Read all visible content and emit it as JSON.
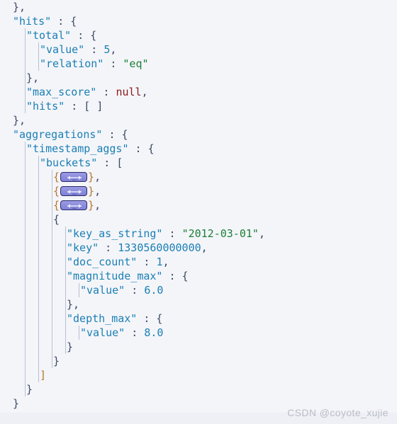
{
  "editor": {
    "background_color": "#f4f5f9",
    "indent_guide_color": "#b9c0d0",
    "colors": {
      "punctuation": "#3b4a66",
      "key": "#1a7fb5",
      "string": "#1a7f37",
      "number": "#1a7fb5",
      "null": "#8b1a1a",
      "fold_brace": "#b8762a",
      "fold_chip_fill": "#8c8cdd",
      "fold_chip_border": "#2b2b6b",
      "watermark": "#b9bdc6"
    },
    "fold_chip": {
      "icon_name": "collapsed-region-arrows-icon",
      "tooltip": "Expand folded region"
    }
  },
  "document": {
    "language": "json",
    "title": "Elasticsearch search response",
    "lines": [
      {
        "n": 1,
        "indent": 0,
        "tokens": [
          {
            "t": "punct",
            "v": "},"
          }
        ]
      },
      {
        "n": 2,
        "indent": 0,
        "tokens": [
          {
            "t": "key",
            "v": "\"hits\""
          },
          {
            "t": "punct",
            "v": " : {"
          }
        ]
      },
      {
        "n": 3,
        "indent": 1,
        "tokens": [
          {
            "t": "key",
            "v": "\"total\""
          },
          {
            "t": "punct",
            "v": " : {"
          }
        ]
      },
      {
        "n": 4,
        "indent": 2,
        "tokens": [
          {
            "t": "key",
            "v": "\"value\""
          },
          {
            "t": "punct",
            "v": " : "
          },
          {
            "t": "num",
            "v": "5"
          },
          {
            "t": "punct",
            "v": ","
          }
        ]
      },
      {
        "n": 5,
        "indent": 2,
        "tokens": [
          {
            "t": "key",
            "v": "\"relation\""
          },
          {
            "t": "punct",
            "v": " : "
          },
          {
            "t": "str",
            "v": "\"eq\""
          }
        ]
      },
      {
        "n": 6,
        "indent": 1,
        "tokens": [
          {
            "t": "punct",
            "v": "},"
          }
        ]
      },
      {
        "n": 7,
        "indent": 1,
        "tokens": [
          {
            "t": "key",
            "v": "\"max_score\""
          },
          {
            "t": "punct",
            "v": " : "
          },
          {
            "t": "null",
            "v": "null"
          },
          {
            "t": "punct",
            "v": ","
          }
        ]
      },
      {
        "n": 8,
        "indent": 1,
        "tokens": [
          {
            "t": "key",
            "v": "\"hits\""
          },
          {
            "t": "punct",
            "v": " : [ ]"
          }
        ]
      },
      {
        "n": 9,
        "indent": 0,
        "tokens": [
          {
            "t": "punct",
            "v": "},"
          }
        ]
      },
      {
        "n": 10,
        "indent": 0,
        "tokens": [
          {
            "t": "key",
            "v": "\"aggregations\""
          },
          {
            "t": "punct",
            "v": " : {"
          }
        ]
      },
      {
        "n": 11,
        "indent": 1,
        "tokens": [
          {
            "t": "key",
            "v": "\"timestamp_aggs\""
          },
          {
            "t": "punct",
            "v": " : {"
          }
        ]
      },
      {
        "n": 12,
        "indent": 2,
        "tokens": [
          {
            "t": "key",
            "v": "\"buckets\""
          },
          {
            "t": "punct",
            "v": " : ["
          }
        ]
      },
      {
        "n": 13,
        "indent": 3,
        "tokens": [
          {
            "t": "fbrace",
            "v": "{"
          },
          {
            "t": "fold",
            "v": ""
          },
          {
            "t": "fbrace",
            "v": "}"
          },
          {
            "t": "punct",
            "v": ","
          }
        ]
      },
      {
        "n": 14,
        "indent": 3,
        "tokens": [
          {
            "t": "fbrace",
            "v": "{"
          },
          {
            "t": "fold",
            "v": ""
          },
          {
            "t": "fbrace",
            "v": "}"
          },
          {
            "t": "punct",
            "v": ","
          }
        ]
      },
      {
        "n": 15,
        "indent": 3,
        "tokens": [
          {
            "t": "fbrace",
            "v": "{"
          },
          {
            "t": "fold",
            "v": ""
          },
          {
            "t": "fbrace",
            "v": "}"
          },
          {
            "t": "punct",
            "v": ","
          }
        ]
      },
      {
        "n": 16,
        "indent": 3,
        "tokens": [
          {
            "t": "punct",
            "v": "{"
          }
        ]
      },
      {
        "n": 17,
        "indent": 4,
        "tokens": [
          {
            "t": "key",
            "v": "\"key_as_string\""
          },
          {
            "t": "punct",
            "v": " : "
          },
          {
            "t": "str",
            "v": "\"2012-03-01\""
          },
          {
            "t": "punct",
            "v": ","
          }
        ]
      },
      {
        "n": 18,
        "indent": 4,
        "tokens": [
          {
            "t": "key",
            "v": "\"key\""
          },
          {
            "t": "punct",
            "v": " : "
          },
          {
            "t": "num",
            "v": "1330560000000"
          },
          {
            "t": "punct",
            "v": ","
          }
        ]
      },
      {
        "n": 19,
        "indent": 4,
        "tokens": [
          {
            "t": "key",
            "v": "\"doc_count\""
          },
          {
            "t": "punct",
            "v": " : "
          },
          {
            "t": "num",
            "v": "1"
          },
          {
            "t": "punct",
            "v": ","
          }
        ]
      },
      {
        "n": 20,
        "indent": 4,
        "tokens": [
          {
            "t": "key",
            "v": "\"magnitude_max\""
          },
          {
            "t": "punct",
            "v": " : {"
          }
        ]
      },
      {
        "n": 21,
        "indent": 5,
        "tokens": [
          {
            "t": "key",
            "v": "\"value\""
          },
          {
            "t": "punct",
            "v": " : "
          },
          {
            "t": "num",
            "v": "6.0"
          }
        ]
      },
      {
        "n": 22,
        "indent": 4,
        "tokens": [
          {
            "t": "punct",
            "v": "},"
          }
        ]
      },
      {
        "n": 23,
        "indent": 4,
        "tokens": [
          {
            "t": "key",
            "v": "\"depth_max\""
          },
          {
            "t": "punct",
            "v": " : {"
          }
        ]
      },
      {
        "n": 24,
        "indent": 5,
        "tokens": [
          {
            "t": "key",
            "v": "\"value\""
          },
          {
            "t": "punct",
            "v": " : "
          },
          {
            "t": "num",
            "v": "8.0"
          }
        ]
      },
      {
        "n": 25,
        "indent": 4,
        "tokens": [
          {
            "t": "punct",
            "v": "}"
          }
        ]
      },
      {
        "n": 26,
        "indent": 3,
        "tokens": [
          {
            "t": "punct",
            "v": "}"
          }
        ]
      },
      {
        "n": 27,
        "indent": 2,
        "tokens": [
          {
            "t": "bracket",
            "v": "]"
          }
        ]
      },
      {
        "n": 28,
        "indent": 1,
        "tokens": [
          {
            "t": "punct",
            "v": "}"
          }
        ]
      },
      {
        "n": 29,
        "indent": 0,
        "tokens": [
          {
            "t": "punct",
            "v": "}"
          }
        ]
      }
    ],
    "indent_guides": [
      {
        "indent": 1,
        "from_line": 3,
        "to_line": 8
      },
      {
        "indent": 2,
        "from_line": 4,
        "to_line": 5
      },
      {
        "indent": 1,
        "from_line": 11,
        "to_line": 28
      },
      {
        "indent": 2,
        "from_line": 12,
        "to_line": 27
      },
      {
        "indent": 3,
        "from_line": 13,
        "to_line": 26
      },
      {
        "indent": 4,
        "from_line": 17,
        "to_line": 25
      },
      {
        "indent": 5,
        "from_line": 21,
        "to_line": 21
      },
      {
        "indent": 5,
        "from_line": 24,
        "to_line": 24
      }
    ]
  },
  "watermark": {
    "text": "CSDN @coyote_xujie"
  }
}
